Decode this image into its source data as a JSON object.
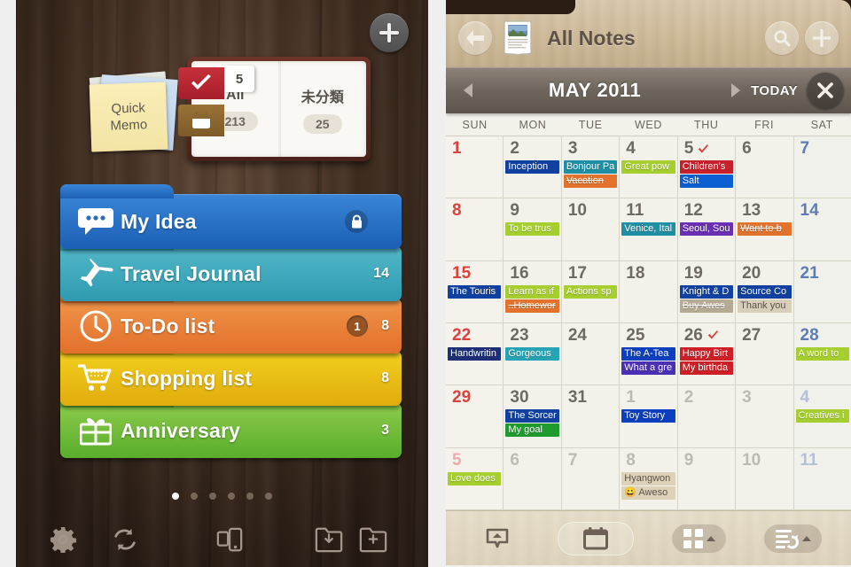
{
  "left_panel": {
    "add_button": "+",
    "quick_memo": {
      "label": "Quick\nMemo",
      "line1": "Quick",
      "line2": "Memo"
    },
    "notebook": {
      "check_tab_badge": "5",
      "pages": [
        {
          "title": "All",
          "count": "213"
        },
        {
          "title": "未分類",
          "count": "25"
        }
      ]
    },
    "folders": [
      {
        "icon": "speech-bubble-icon",
        "label": "My Idea",
        "count": "",
        "badge": "",
        "locked": true,
        "color": "#1f6fc4"
      },
      {
        "icon": "airplane-icon",
        "label": "Travel Journal",
        "count": "14",
        "badge": "",
        "locked": false,
        "color": "#3aa8bd"
      },
      {
        "icon": "clock-icon",
        "label": "To-Do list",
        "count": "8",
        "badge": "1",
        "locked": false,
        "color": "#e8833a"
      },
      {
        "icon": "cart-icon",
        "label": "Shopping list",
        "count": "8",
        "badge": "",
        "locked": false,
        "color": "#e8c01a"
      },
      {
        "icon": "gift-icon",
        "label": "Anniversary",
        "count": "3",
        "badge": "",
        "locked": false,
        "color": "#6cb838"
      }
    ],
    "page_dots": {
      "total": 6,
      "active": 1
    },
    "toolbar": [
      {
        "name": "settings-gear-icon"
      },
      {
        "name": "sync-refresh-icon"
      },
      {
        "name": "device-transfer-icon"
      },
      {
        "name": "folder-download-icon"
      },
      {
        "name": "folder-add-icon"
      }
    ]
  },
  "right_panel": {
    "header": {
      "back": "back-arrow-icon",
      "doc_icon": "notes-book-icon",
      "title": "All Notes",
      "search": "search-icon",
      "add": "plus-icon"
    },
    "monthbar": {
      "prev": "◀",
      "month": "MAY 2011",
      "next": "▶",
      "today": "TODAY",
      "close": "✕"
    },
    "weekdays": [
      "SUN",
      "MON",
      "TUE",
      "WED",
      "THU",
      "FRI",
      "SAT"
    ],
    "colors": {
      "sunday": "#e0403c",
      "saturday": "#5d7bb5",
      "weekday": "#6e6a62",
      "check": "#e0403c"
    },
    "toolbar": [
      {
        "name": "note-popup-icon",
        "style": "plain"
      },
      {
        "name": "calendar-icon",
        "style": "pill"
      },
      {
        "name": "grid-view-icon",
        "style": "filled",
        "caret": true
      },
      {
        "name": "sort-list-icon",
        "style": "filled",
        "caret": true
      }
    ],
    "weeks": [
      [
        {
          "day": "1",
          "dim": false,
          "kind": "sun",
          "check": false,
          "events": []
        },
        {
          "day": "2",
          "dim": false,
          "kind": "wd",
          "check": false,
          "events": [
            {
              "text": "Inception",
              "color": "#1141a0",
              "done": false,
              "dark": false
            }
          ]
        },
        {
          "day": "3",
          "dim": false,
          "kind": "wd",
          "check": false,
          "events": [
            {
              "text": "Bonjour Pa",
              "color": "#1f8fa6",
              "done": false,
              "dark": false
            },
            {
              "text": "Vacation",
              "color": "#e2681c",
              "done": true,
              "dark": false
            }
          ]
        },
        {
          "day": "4",
          "dim": false,
          "kind": "wd",
          "check": false,
          "events": [
            {
              "text": "Great pow",
              "color": "#a5ce2e",
              "done": false,
              "dark": false
            }
          ]
        },
        {
          "day": "5",
          "dim": false,
          "kind": "wd",
          "check": true,
          "events": [
            {
              "text": "Children's",
              "color": "#c8202a",
              "done": false,
              "dark": false
            },
            {
              "text": "Salt",
              "color": "#0b5fd0",
              "done": false,
              "dark": false
            }
          ]
        },
        {
          "day": "6",
          "dim": false,
          "kind": "wd",
          "check": false,
          "events": []
        },
        {
          "day": "7",
          "dim": false,
          "kind": "sat",
          "check": false,
          "events": []
        }
      ],
      [
        {
          "day": "8",
          "dim": false,
          "kind": "sun",
          "check": false,
          "events": []
        },
        {
          "day": "9",
          "dim": false,
          "kind": "wd",
          "check": false,
          "events": [
            {
              "text": "To be trus",
              "color": "#a5ce2e",
              "done": false,
              "dark": false
            }
          ]
        },
        {
          "day": "10",
          "dim": false,
          "kind": "wd",
          "check": false,
          "events": []
        },
        {
          "day": "11",
          "dim": false,
          "kind": "wd",
          "check": false,
          "events": [
            {
              "text": "Venice, Ital",
              "color": "#1f8fa6",
              "done": false,
              "dark": false
            }
          ]
        },
        {
          "day": "12",
          "dim": false,
          "kind": "wd",
          "check": false,
          "events": [
            {
              "text": "Seoul, Sou",
              "color": "#6a2fb5",
              "done": false,
              "dark": false
            }
          ]
        },
        {
          "day": "13",
          "dim": false,
          "kind": "wd",
          "check": false,
          "events": [
            {
              "text": "Want to b",
              "color": "#e2681c",
              "done": true,
              "dark": false
            }
          ]
        },
        {
          "day": "14",
          "dim": false,
          "kind": "sat",
          "check": false,
          "events": []
        }
      ],
      [
        {
          "day": "15",
          "dim": false,
          "kind": "sun",
          "check": false,
          "events": [
            {
              "text": "The Touris",
              "color": "#1141a0",
              "done": false,
              "dark": false
            }
          ]
        },
        {
          "day": "16",
          "dim": false,
          "kind": "wd",
          "check": false,
          "events": [
            {
              "text": "Learn as if",
              "color": "#a5ce2e",
              "done": false,
              "dark": false
            },
            {
              "text": "..Homewor",
              "color": "#e2681c",
              "done": true,
              "dark": false
            }
          ]
        },
        {
          "day": "17",
          "dim": false,
          "kind": "wd",
          "check": false,
          "events": [
            {
              "text": "Actions sp",
              "color": "#a5ce2e",
              "done": false,
              "dark": false
            }
          ]
        },
        {
          "day": "18",
          "dim": false,
          "kind": "wd",
          "check": false,
          "events": []
        },
        {
          "day": "19",
          "dim": false,
          "kind": "wd",
          "check": false,
          "events": [
            {
              "text": "Knight & D",
              "color": "#1141a0",
              "done": false,
              "dark": false
            },
            {
              "text": "Buy Awes",
              "color": "#b0a48c",
              "done": true,
              "dark": false
            }
          ]
        },
        {
          "day": "20",
          "dim": false,
          "kind": "wd",
          "check": false,
          "events": [
            {
              "text": "Source Co",
              "color": "#1141a0",
              "done": false,
              "dark": false
            },
            {
              "text": "Thank you",
              "color": "#d8cfba",
              "done": false,
              "dark": true
            }
          ]
        },
        {
          "day": "21",
          "dim": false,
          "kind": "sat",
          "check": false,
          "events": []
        }
      ],
      [
        {
          "day": "22",
          "dim": false,
          "kind": "sun",
          "check": false,
          "events": [
            {
              "text": "Handwritin",
              "color": "#1c2f77",
              "done": false,
              "dark": false
            }
          ]
        },
        {
          "day": "23",
          "dim": false,
          "kind": "wd",
          "check": false,
          "events": [
            {
              "text": "Gorgeous",
              "color": "#26a3b5",
              "done": false,
              "dark": false
            }
          ]
        },
        {
          "day": "24",
          "dim": false,
          "kind": "wd",
          "check": false,
          "events": []
        },
        {
          "day": "25",
          "dim": false,
          "kind": "wd",
          "check": false,
          "events": [
            {
              "text": "The A-Tea",
              "color": "#0b3fc0",
              "done": false,
              "dark": false
            },
            {
              "text": "What a gre",
              "color": "#4b2fb5",
              "done": false,
              "dark": false
            }
          ]
        },
        {
          "day": "26",
          "dim": false,
          "kind": "wd",
          "check": true,
          "events": [
            {
              "text": "Happy Birt",
              "color": "#cf1f26",
              "done": false,
              "dark": false
            },
            {
              "text": "My birthda",
              "color": "#cf1f26",
              "done": false,
              "dark": false
            }
          ]
        },
        {
          "day": "27",
          "dim": false,
          "kind": "wd",
          "check": false,
          "events": []
        },
        {
          "day": "28",
          "dim": false,
          "kind": "sat",
          "check": false,
          "events": [
            {
              "text": "A word to",
              "color": "#a5ce2e",
              "done": false,
              "dark": false
            }
          ]
        }
      ],
      [
        {
          "day": "29",
          "dim": false,
          "kind": "sun",
          "check": false,
          "events": []
        },
        {
          "day": "30",
          "dim": false,
          "kind": "wd",
          "check": false,
          "events": [
            {
              "text": "The Sorcer",
              "color": "#1141a0",
              "done": false,
              "dark": false
            },
            {
              "text": "My goal",
              "color": "#1f9b2e",
              "done": false,
              "dark": false
            }
          ]
        },
        {
          "day": "31",
          "dim": false,
          "kind": "wd",
          "check": false,
          "events": []
        },
        {
          "day": "1",
          "dim": true,
          "kind": "wd",
          "check": false,
          "events": [
            {
              "text": "Toy Story",
              "color": "#0b3fc0",
              "done": false,
              "dark": false
            }
          ]
        },
        {
          "day": "2",
          "dim": true,
          "kind": "wd",
          "check": false,
          "events": []
        },
        {
          "day": "3",
          "dim": true,
          "kind": "wd",
          "check": false,
          "events": []
        },
        {
          "day": "4",
          "dim": true,
          "kind": "sat",
          "check": false,
          "events": [
            {
              "text": "Creatives i",
              "color": "#a5ce2e",
              "done": false,
              "dark": false
            }
          ]
        }
      ],
      [
        {
          "day": "5",
          "dim": true,
          "kind": "sun",
          "check": false,
          "events": [
            {
              "text": "Love does",
              "color": "#a5ce2e",
              "done": false,
              "dark": false
            }
          ]
        },
        {
          "day": "6",
          "dim": true,
          "kind": "wd",
          "check": false,
          "events": []
        },
        {
          "day": "7",
          "dim": true,
          "kind": "wd",
          "check": false,
          "events": []
        },
        {
          "day": "8",
          "dim": true,
          "kind": "wd",
          "check": false,
          "events": [
            {
              "text": "Hyangwon",
              "color": "#ddd2b8",
              "done": false,
              "dark": true
            },
            {
              "text": "😀 Aweso",
              "color": "#ddd2b8",
              "done": false,
              "dark": true
            }
          ]
        },
        {
          "day": "9",
          "dim": true,
          "kind": "wd",
          "check": false,
          "events": []
        },
        {
          "day": "10",
          "dim": true,
          "kind": "wd",
          "check": false,
          "events": []
        },
        {
          "day": "11",
          "dim": true,
          "kind": "sat",
          "check": false,
          "events": []
        }
      ]
    ]
  }
}
